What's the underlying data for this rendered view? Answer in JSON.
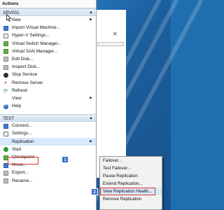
{
  "actions_pane": {
    "title": "Actions",
    "server_section": {
      "name": "SRV001",
      "items": [
        {
          "label": "New",
          "icon": "new-icon",
          "has_submenu": true
        },
        {
          "label": "Import Virtual Machine...",
          "icon": "import-vm-icon"
        },
        {
          "label": "Hyper-V Settings...",
          "icon": "hyperv-settings-icon"
        },
        {
          "label": "Virtual Switch Manager...",
          "icon": "switch-manager-icon"
        },
        {
          "label": "Virtual SAN Manager...",
          "icon": "san-manager-icon"
        },
        {
          "label": "Edit Disk...",
          "icon": "edit-disk-icon"
        },
        {
          "label": "Inspect Disk...",
          "icon": "inspect-disk-icon"
        },
        {
          "label": "Stop Service",
          "icon": "stop-icon"
        },
        {
          "label": "Remove Server",
          "icon": "remove-icon"
        },
        {
          "label": "Refresh",
          "icon": "refresh-icon"
        },
        {
          "label": "View",
          "icon": "view-icon",
          "has_submenu": true
        },
        {
          "label": "Help",
          "icon": "help-icon"
        }
      ]
    },
    "vm_section": {
      "name": "TEST",
      "items": [
        {
          "label": "Connect...",
          "icon": "connect-icon"
        },
        {
          "label": "Settings...",
          "icon": "settings-icon"
        },
        {
          "label": "Replication",
          "icon": "replication-icon",
          "has_submenu": true
        },
        {
          "label": "Start",
          "icon": "start-icon"
        },
        {
          "label": "Checkpoint",
          "icon": "checkpoint-icon"
        },
        {
          "label": "Move...",
          "icon": "move-icon"
        },
        {
          "label": "Export...",
          "icon": "export-icon"
        },
        {
          "label": "Rename...",
          "icon": "rename-icon"
        }
      ]
    }
  },
  "replication_submenu": {
    "items": [
      {
        "label": "Failover..."
      },
      {
        "label": "Test Failover..."
      },
      {
        "label": "Pause Replication"
      },
      {
        "label": "Extend Replication..."
      },
      {
        "label": "View Replication Health..."
      },
      {
        "label": "Remove Replication"
      }
    ]
  },
  "step_badges": [
    "1",
    "2"
  ],
  "colors": {
    "highlight": "#d9342b",
    "badge": "#3370c7",
    "section_header": "#d4e1ef"
  }
}
